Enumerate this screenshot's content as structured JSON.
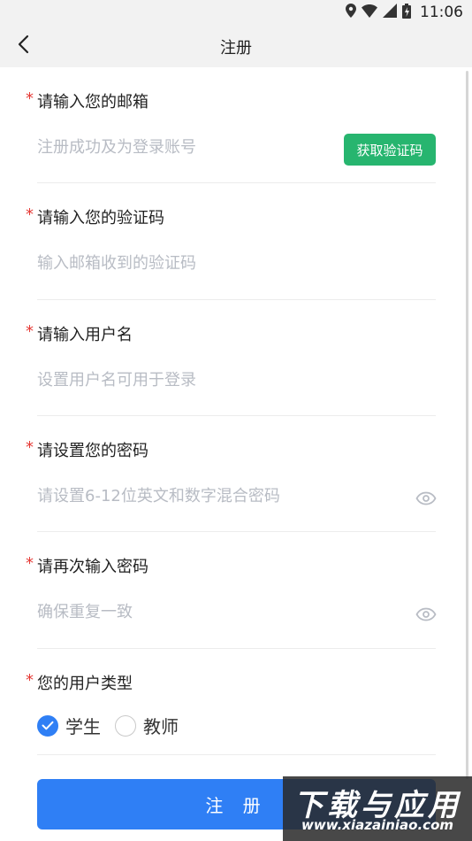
{
  "status_bar": {
    "time": "11:06",
    "icons": [
      "location-icon",
      "wifi-icon",
      "signal-icon",
      "battery-icon"
    ]
  },
  "nav": {
    "title": "注册",
    "back_icon": "chevron-left-icon"
  },
  "form": {
    "required_mark": "*",
    "email": {
      "label": "请输入您的邮箱",
      "placeholder": "注册成功及为登录账号",
      "value": ""
    },
    "get_code_button": "获取验证码",
    "code": {
      "label": "请输入您的验证码",
      "placeholder": "输入邮箱收到的验证码",
      "value": ""
    },
    "username": {
      "label": "请输入用户名",
      "placeholder": "设置用户名可用于登录",
      "value": ""
    },
    "password": {
      "label": "请设置您的密码",
      "placeholder": "请设置6-12位英文和数字混合密码",
      "value": "",
      "toggle_icon": "eye-icon"
    },
    "confirm_password": {
      "label": "请再次输入密码",
      "placeholder": "确保重复一致",
      "value": "",
      "toggle_icon": "eye-icon"
    },
    "user_type": {
      "label": "您的用户类型",
      "options": [
        {
          "label": "学生",
          "selected": true
        },
        {
          "label": "教师",
          "selected": false
        }
      ]
    },
    "submit_button": "注 册"
  },
  "watermark": {
    "title": "下载与应用",
    "url": "www.xiazainiao.com"
  },
  "colors": {
    "accent_blue": "#2f7ff5",
    "green_button": "#27b56f",
    "required_red": "#e53935",
    "placeholder_gray": "#b8bcc4"
  }
}
